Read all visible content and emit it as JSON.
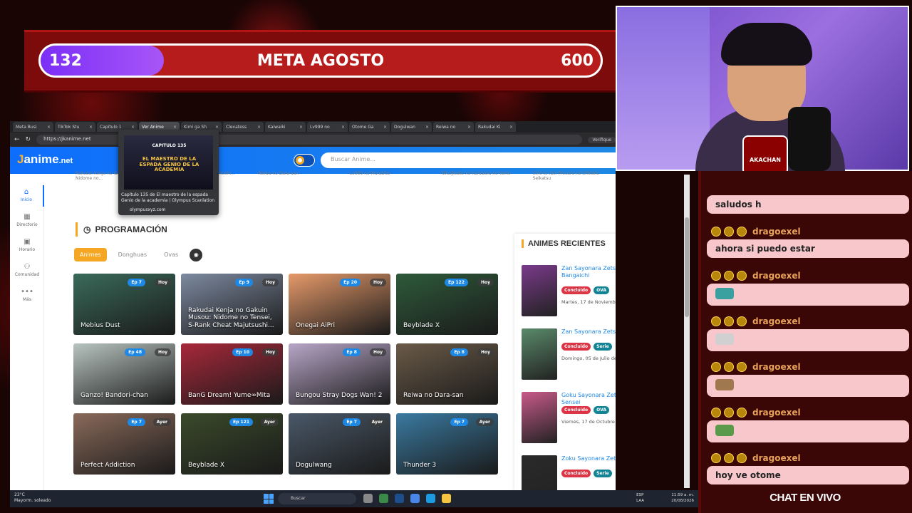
{
  "goal": {
    "current": "132",
    "title": "META AGOSTO",
    "target": "600",
    "progress_fraction": 0.22
  },
  "browser": {
    "tabs": [
      {
        "label": "Meta Busi",
        "active": false
      },
      {
        "label": "TikTok Stu",
        "active": false
      },
      {
        "label": "Capítulo 1",
        "active": false
      },
      {
        "label": "Ver Anime",
        "active": true
      },
      {
        "label": "Kimi ga Sh",
        "active": false
      },
      {
        "label": "Clevatess",
        "active": false
      },
      {
        "label": "Kaiwaiki",
        "active": false
      },
      {
        "label": "Lv999 no",
        "active": false
      },
      {
        "label": "Otome Ga",
        "active": false
      },
      {
        "label": "Dogulwan",
        "active": false
      },
      {
        "label": "Reiwa no",
        "active": false
      },
      {
        "label": "Rakudai Ki",
        "active": false
      }
    ],
    "url": "https://jkanime.net",
    "verify_label": "Verifique"
  },
  "preview": {
    "image_text": "EL MAESTRO DE LA ESPADA GENIO DE LA ACADEMIA",
    "chapter_text": "CAPITULO 135",
    "title": "Capítulo 135 de El maestro de la espada Genio de la academia | Olympus Scanlation",
    "site": "olympusxyz.com"
  },
  "site": {
    "logo_j": "J",
    "logo_rest": "anime",
    "logo_tld": ".net",
    "search_placeholder": "Buscar Anime...",
    "topstrip": [
      "Rakudai Kenja no Gakuin Musou: Nidome no...",
      "Kimi ga Shinda Natsu ni Kuchi...",
      "Reiwa no Dara-san",
      "Lv999 no Murabito",
      "Kikaijikake no Kurobara no Yome",
      "Kimi to Idol Precure no Shikaku Seikatsu"
    ],
    "nav": [
      {
        "icon": "⌂",
        "label": "Inicio",
        "active": true
      },
      {
        "icon": "▦",
        "label": "Directorio",
        "active": false
      },
      {
        "icon": "▣",
        "label": "Horario",
        "active": false
      },
      {
        "icon": "⚇",
        "label": "Comunidad",
        "active": false
      },
      {
        "icon": "•••",
        "label": "Más",
        "active": false
      }
    ],
    "section_title": "PROGRAMACIÓN",
    "filters": [
      "Animes",
      "Donghuas",
      "Ovas"
    ],
    "cards": [
      {
        "name": "Mebius Dust",
        "ep": "Ep 7",
        "day": "Hoy",
        "color": "#3a6b5a"
      },
      {
        "name": "Rakudai Kenja no Gakuin Musou: Nidome no Tensei, S-Rank Cheat Majutsushi...",
        "ep": "Ep 9",
        "day": "Hoy",
        "color": "#7d8aa0"
      },
      {
        "name": "Onegai AiPri",
        "ep": "Ep 20",
        "day": "Hoy",
        "color": "#e69a6a"
      },
      {
        "name": "Beyblade X",
        "ep": "Ep 122",
        "day": "Hoy",
        "color": "#2e5a3a"
      },
      {
        "name": "Ganzo! Bandori-chan",
        "ep": "Ep 48",
        "day": "Hoy",
        "color": "#b8c4c0"
      },
      {
        "name": "BanG Dream! Yume∞Mita",
        "ep": "Ep 10",
        "day": "Hoy",
        "color": "#a8283a"
      },
      {
        "name": "Bungou Stray Dogs Wan! 2",
        "ep": "Ep 8",
        "day": "Hoy",
        "color": "#b8a6c8"
      },
      {
        "name": "Reiwa no Dara-san",
        "ep": "Ep 8",
        "day": "Hoy",
        "color": "#6a5a48"
      },
      {
        "name": "Perfect Addiction",
        "ep": "Ep 7",
        "day": "Ayer",
        "color": "#8a6a5a"
      },
      {
        "name": "Beyblade X",
        "ep": "Ep 121",
        "day": "Ayer",
        "color": "#3a4a2a"
      },
      {
        "name": "Dogulwang",
        "ep": "Ep 7",
        "day": "Ayer",
        "color": "#4a5868"
      },
      {
        "name": "Thunder 3",
        "ep": "Ep 7",
        "day": "Ayer",
        "color": "#3a7aa0"
      }
    ],
    "recent_title": "ANIMES RECIENTES",
    "recent": [
      {
        "title": "Zan Sayonara Zetsubou Sensei Bangaichi",
        "status": "Concluido",
        "type": "OVA",
        "date": "Martes, 17 de Noviembre de 2009",
        "color": "#7a3a8a"
      },
      {
        "title": "Zan Sayonara Zetsubou Sensei",
        "status": "Concluido",
        "type": "Serie",
        "date": "Domingo, 05 de Julio de 2009",
        "color": "#5a8a6a"
      },
      {
        "title": "Goku Sayonara Zetsubou Sensei",
        "status": "Concluido",
        "type": "OVA",
        "date": "Viernes, 17 de Octubre de 2008",
        "color": "#c85a8a"
      },
      {
        "title": "Zoku Sayonara Zetsubou Sensei",
        "status": "Concluido",
        "type": "Serie",
        "date": "",
        "color": "#2a2a2a"
      }
    ]
  },
  "webcam": {
    "badge": "AKACHAN"
  },
  "chat": {
    "messages": [
      {
        "user": "",
        "text": "saludos h"
      },
      {
        "user": "dragoexel",
        "text": "ahora si puedo estar"
      },
      {
        "user": "dragoexel",
        "text": "",
        "emote": "#3aa0a0"
      },
      {
        "user": "dragoexel",
        "text": "",
        "emote": "#d0d0d0"
      },
      {
        "user": "dragoexel",
        "text": "",
        "emote": "#a07850"
      },
      {
        "user": "dragoexel",
        "text": "",
        "emote": "#5a9a4a"
      },
      {
        "user": "dragoexel",
        "text": "hoy ve otome"
      }
    ],
    "title": "CHAT EN VIVO"
  },
  "taskbar": {
    "temp": "23°C",
    "weather": "Mayorm. soleado",
    "search": "Buscar",
    "lang": "ESP\nLAA",
    "time": "11:59 a. m.",
    "date": "20/08/2026"
  }
}
